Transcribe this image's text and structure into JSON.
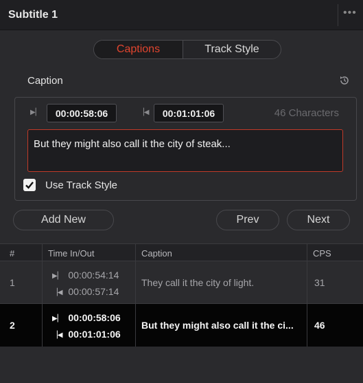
{
  "panel": {
    "title": "Subtitle 1",
    "more_icon": "more-icon"
  },
  "tabs": {
    "captions": "Captions",
    "track_style": "Track Style",
    "active_color": "#e0452f"
  },
  "caption_section": {
    "heading": "Caption",
    "reset_icon": "reset-icon",
    "time_in": "00:00:58:06",
    "time_out": "00:01:01:06",
    "char_count": "46 Characters",
    "text": "But they might also call it the city of steak...",
    "use_track_style_label": "Use Track Style",
    "use_track_style_checked": true
  },
  "actions": {
    "add_new": "Add New",
    "prev": "Prev",
    "next": "Next"
  },
  "table": {
    "columns": [
      "#",
      "Time In/Out",
      "Caption",
      "CPS"
    ],
    "rows": [
      {
        "num": "1",
        "time_in": "00:00:54:14",
        "time_out": "00:00:57:14",
        "caption": "They call it the city of light.",
        "cps": "31",
        "selected": false
      },
      {
        "num": "2",
        "time_in": "00:00:58:06",
        "time_out": "00:01:01:06",
        "caption": "But they might also call it the ci...",
        "cps": "46",
        "selected": true
      }
    ]
  },
  "colors": {
    "accent": "#e0452f",
    "selected_row": "#050505",
    "panel_bg": "#2a2a2d"
  }
}
